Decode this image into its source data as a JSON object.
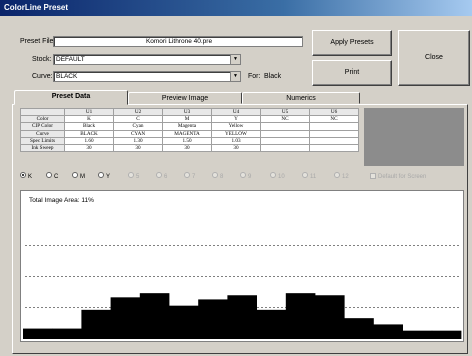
{
  "window": {
    "title": "ColorLine Preset"
  },
  "preset_file": {
    "label": "Preset File:",
    "value": "Komori Lithrone 40.pre"
  },
  "stock": {
    "label": "Stock:",
    "value": "DEFAULT"
  },
  "curve": {
    "label": "Curve:",
    "value": "BLACK",
    "for_label": "For:",
    "for_value": "Black"
  },
  "buttons": {
    "apply": "Apply Presets",
    "print": "Print",
    "close": "Close"
  },
  "tabs": [
    {
      "label": "Preset Data",
      "active": true
    },
    {
      "label": "Preview Image",
      "active": false
    },
    {
      "label": "Numerics",
      "active": false
    }
  ],
  "table": {
    "columns": [
      "U1",
      "U2",
      "U3",
      "U4",
      "U5",
      "U6"
    ],
    "rows": [
      {
        "label": "Color",
        "cells": [
          "K",
          "C",
          "M",
          "Y",
          "NC",
          "NC"
        ]
      },
      {
        "label": "CIP Color",
        "cells": [
          "Black",
          "Cyan",
          "Magenta",
          "Yellow",
          "",
          ""
        ]
      },
      {
        "label": "Curve",
        "cells": [
          "BLACK",
          "CYAN",
          "MAGENTA",
          "YELLOW",
          "",
          ""
        ]
      },
      {
        "label": "Spec Limits",
        "cells": [
          "1.60",
          "1.30",
          "1.50",
          "1.03",
          "",
          ""
        ]
      },
      {
        "label": "Ink Sweep",
        "cells": [
          "30",
          "30",
          "30",
          "30",
          "",
          ""
        ]
      }
    ]
  },
  "radios": [
    {
      "label": "K",
      "selected": true,
      "enabled": true
    },
    {
      "label": "C",
      "selected": false,
      "enabled": true
    },
    {
      "label": "M",
      "selected": false,
      "enabled": true
    },
    {
      "label": "Y",
      "selected": false,
      "enabled": true
    },
    {
      "label": "5",
      "selected": false,
      "enabled": false
    },
    {
      "label": "6",
      "selected": false,
      "enabled": false
    },
    {
      "label": "7",
      "selected": false,
      "enabled": false
    },
    {
      "label": "8",
      "selected": false,
      "enabled": false
    },
    {
      "label": "9",
      "selected": false,
      "enabled": false
    },
    {
      "label": "10",
      "selected": false,
      "enabled": false
    },
    {
      "label": "11",
      "selected": false,
      "enabled": false
    },
    {
      "label": "12",
      "selected": false,
      "enabled": false
    }
  ],
  "default_checkbox": {
    "label": "Default for Screen",
    "enabled": false
  },
  "chart": {
    "title": "Total Image Area: 11%"
  },
  "chart_data": {
    "type": "bar",
    "values": [
      5,
      5,
      14,
      20,
      22,
      16,
      19,
      21,
      14,
      22,
      21,
      10,
      7,
      4,
      4
    ],
    "ylim": [
      0,
      60
    ],
    "grid": true,
    "gridlines": [
      15,
      30,
      45
    ],
    "bar_color": "#000000"
  }
}
